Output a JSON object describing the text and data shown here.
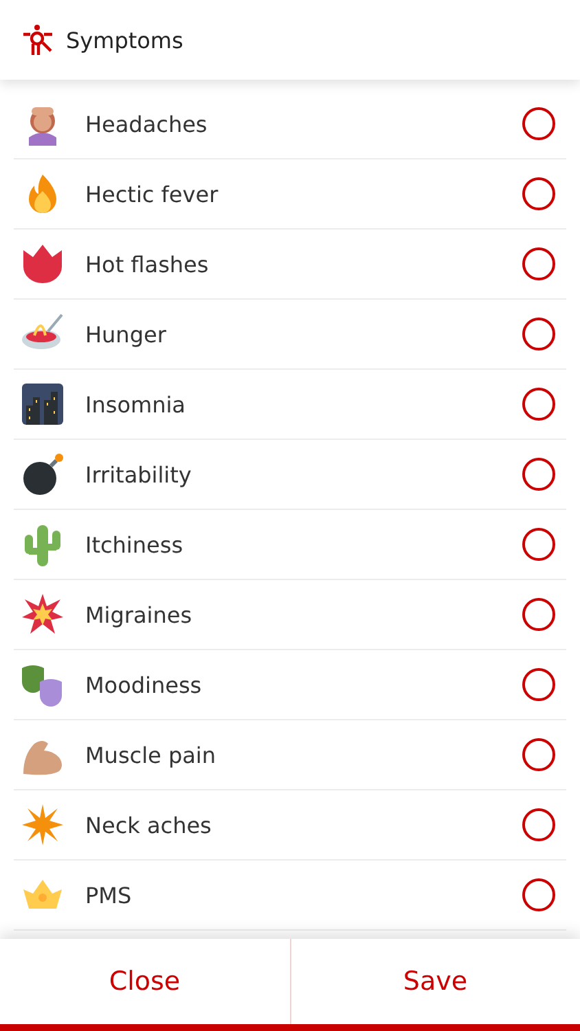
{
  "header": {
    "title": "Symptoms"
  },
  "symptoms": [
    {
      "label": "Headaches",
      "checked": false
    },
    {
      "label": "Hectic fever",
      "checked": false
    },
    {
      "label": "Hot flashes",
      "checked": false
    },
    {
      "label": "Hunger",
      "checked": false
    },
    {
      "label": "Insomnia",
      "checked": false
    },
    {
      "label": "Irritability",
      "checked": false
    },
    {
      "label": "Itchiness",
      "checked": false
    },
    {
      "label": "Migraines",
      "checked": false
    },
    {
      "label": "Moodiness",
      "checked": false
    },
    {
      "label": "Muscle pain",
      "checked": false
    },
    {
      "label": "Neck aches",
      "checked": false
    },
    {
      "label": "PMS",
      "checked": false
    }
  ],
  "buttons": [
    "Close",
    "Save"
  ]
}
